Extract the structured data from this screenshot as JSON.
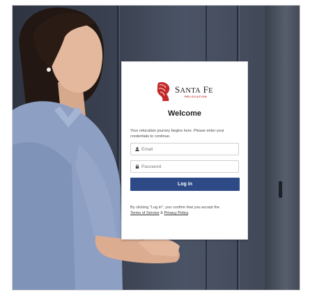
{
  "brand": {
    "name_part1": "S",
    "name_part1_small": "ANTA",
    "name_part2": " F",
    "name_part2_small": "E",
    "subtitle": "RELOCATION",
    "logo_icon": "horse-head-logo-icon",
    "accent_color": "#c42a2a"
  },
  "login": {
    "heading": "Welcome",
    "intro": "Your relocation journey begins here. Please enter your credentials to continue.",
    "email_placeholder": "Email",
    "password_placeholder": "Password",
    "email_icon": "user-icon",
    "password_icon": "lock-icon",
    "submit_label": "Log in",
    "button_color": "#2d4a86"
  },
  "legal": {
    "prefix": "By clicking \"Log in\", you confirm that you accept the",
    "terms_label": "Terms of Service",
    "separator": " & ",
    "privacy_label": "Privacy Policy",
    "suffix": "."
  }
}
